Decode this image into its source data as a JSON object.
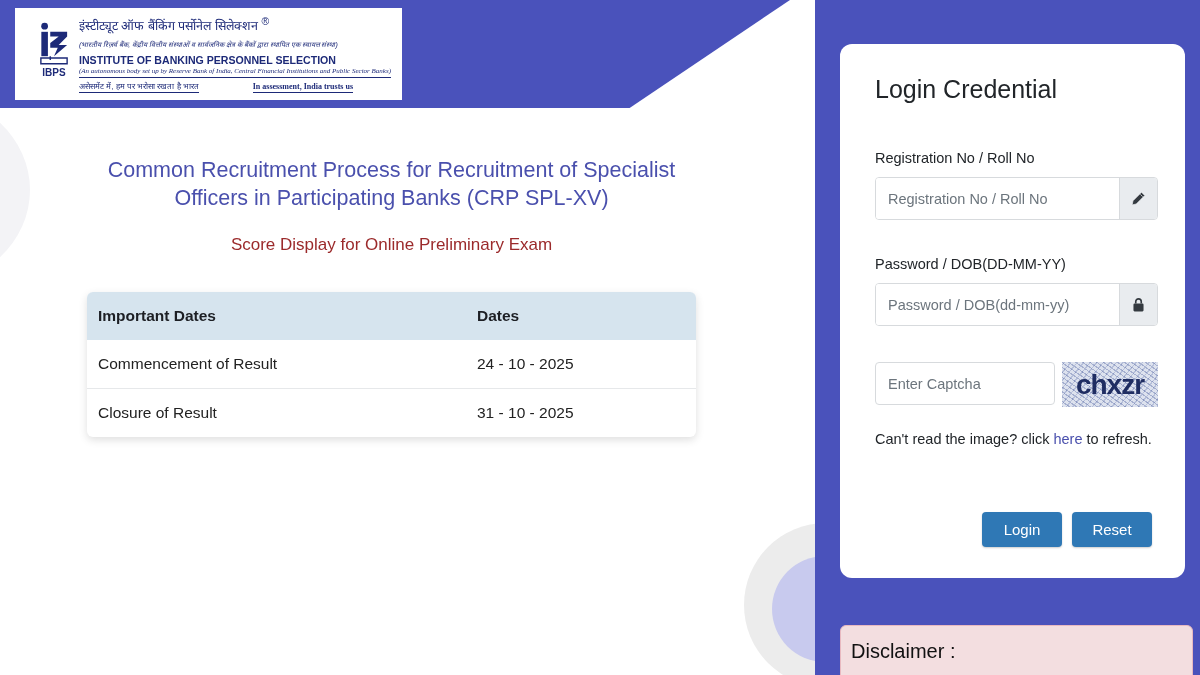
{
  "header": {
    "logo": {
      "emblem_label": "IBPS",
      "hindi_name": "इंस्टीट्यूट ऑफ बैंकिंग पर्सोनेल सिलेक्शन $^{®}$",
      "hindi_subtitle": "(भारतीय रिज़र्व बैंक, केंद्रीय वित्तीय संस्थाओं व सार्वजनिक क्षेत्र के बैंकों द्वारा स्थापित एक स्वायत्त संस्था)",
      "english_name": "INSTITUTE OF BANKING PERSONNEL SELECTION",
      "english_subtitle": "(An autonomous body set up by Reserve Bank of India, Central Financial Institutions and Public Sector Banks)",
      "hindi_tagline": "असेसमेंट में, हम पर भरोसा रखता है भारत",
      "english_tagline": "In assessment, India trusts us"
    }
  },
  "title": "Common Recruitment Process for Recruitment of Specialist Officers in Participating Banks (CRP SPL-XV)",
  "subtitle": "Score Display for Online Preliminary Exam",
  "dates_table": {
    "columns": [
      "Important Dates",
      "Dates"
    ],
    "rows": [
      [
        "Commencement of Result",
        "24 - 10 - 2025"
      ],
      [
        "Closure of Result",
        "31 - 10 - 2025"
      ]
    ]
  },
  "login": {
    "title": "Login Credential",
    "fields": [
      {
        "kind": "text",
        "label": "Registration No / Roll No",
        "placeholder": "Registration No / Roll No"
      },
      {
        "kind": "password",
        "label": "Password / DOB(DD-MM-YY)",
        "placeholder": "Password / DOB(dd-mm-yy)"
      }
    ],
    "captcha": {
      "placeholder": "Enter Captcha",
      "image_text": "chxzr"
    },
    "refresh_note": {
      "before": "Can't read the image? click ",
      "link": "here",
      "after": " to refresh."
    },
    "buttons": [
      "Login",
      "Reset"
    ]
  },
  "disclaimer": {
    "title": "Disclaimer :"
  }
}
